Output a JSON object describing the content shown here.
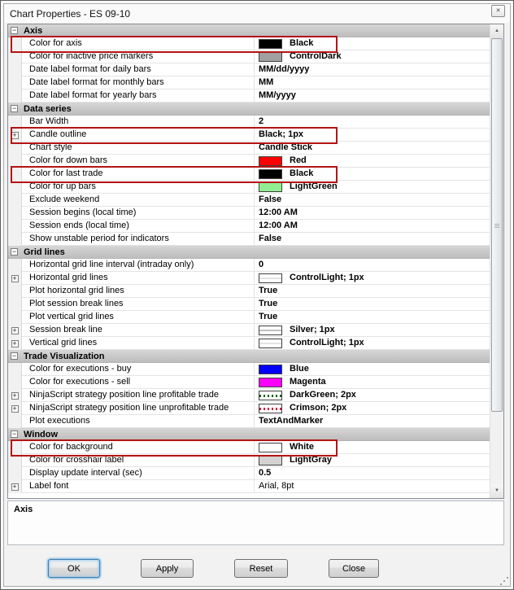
{
  "window": {
    "title": "Chart Properties - ES 09-10"
  },
  "icons": {
    "close": "✕",
    "collapse": "−",
    "expand": "+",
    "scroll_up": "▲",
    "scroll_down": "▼"
  },
  "grid": {
    "sections": [
      {
        "label": "Axis",
        "rows": [
          {
            "name": "Color for axis",
            "value": "Black",
            "swatch": {
              "type": "solid",
              "color": "#000000"
            },
            "highlighted": true
          },
          {
            "name": "Color for inactive price markers",
            "value": "ControlDark",
            "swatch": {
              "type": "solid",
              "color": "#A0A0A0"
            }
          },
          {
            "name": "Date label format for daily bars",
            "value": "MM/dd/yyyy"
          },
          {
            "name": "Date label format for monthly bars",
            "value": "MM"
          },
          {
            "name": "Date label format for yearly bars",
            "value": "MM/yyyy"
          }
        ]
      },
      {
        "label": "Data series",
        "rows": [
          {
            "name": "Bar Width",
            "value": "2"
          },
          {
            "name": "Candle outline",
            "value": "Black; 1px",
            "expandable": true,
            "highlighted": true
          },
          {
            "name": "Chart style",
            "value": "Candle Stick"
          },
          {
            "name": "Color for down bars",
            "value": "Red",
            "swatch": {
              "type": "solid",
              "color": "#FF0000"
            }
          },
          {
            "name": "Color for last trade",
            "value": "Black",
            "swatch": {
              "type": "solid",
              "color": "#000000"
            },
            "highlighted": true
          },
          {
            "name": "Color for up bars",
            "value": "LightGreen",
            "swatch": {
              "type": "solid",
              "color": "#90EE90"
            }
          },
          {
            "name": "Exclude weekend",
            "value": "False"
          },
          {
            "name": "Session begins (local time)",
            "value": "12:00 AM"
          },
          {
            "name": "Session ends (local time)",
            "value": "12:00 AM"
          },
          {
            "name": "Show unstable period for indicators",
            "value": "False"
          }
        ]
      },
      {
        "label": "Grid lines",
        "rows": [
          {
            "name": "Horizontal grid line interval (intraday only)",
            "value": "0"
          },
          {
            "name": "Horizontal grid lines",
            "value": "ControlLight; 1px",
            "expandable": true,
            "swatch": {
              "type": "line",
              "color": "#E3E3E3"
            }
          },
          {
            "name": "Plot horizontal grid lines",
            "value": "True"
          },
          {
            "name": "Plot session break lines",
            "value": "True"
          },
          {
            "name": "Plot vertical grid lines",
            "value": "True"
          },
          {
            "name": "Session break line",
            "value": "Silver; 1px",
            "expandable": true,
            "swatch": {
              "type": "line",
              "color": "#C0C0C0"
            }
          },
          {
            "name": "Vertical grid lines",
            "value": "ControlLight; 1px",
            "expandable": true,
            "swatch": {
              "type": "line",
              "color": "#E3E3E3"
            }
          }
        ]
      },
      {
        "label": "Trade Visualization",
        "rows": [
          {
            "name": "Color for executions - buy",
            "value": "Blue",
            "swatch": {
              "type": "solid",
              "color": "#0000FF"
            }
          },
          {
            "name": "Color for executions - sell",
            "value": "Magenta",
            "swatch": {
              "type": "solid",
              "color": "#FF00FF"
            }
          },
          {
            "name": "NinjaScript strategy position line profitable trade",
            "value": "DarkGreen; 2px",
            "expandable": true,
            "swatch": {
              "type": "dotted",
              "color": "#006400"
            }
          },
          {
            "name": "NinjaScript strategy position line unprofitable trade",
            "value": "Crimson; 2px",
            "expandable": true,
            "swatch": {
              "type": "dotted",
              "color": "#DC143C"
            }
          },
          {
            "name": "Plot executions",
            "value": "TextAndMarker"
          }
        ]
      },
      {
        "label": "Window",
        "rows": [
          {
            "name": "Color for background",
            "value": "White",
            "swatch": {
              "type": "solid",
              "color": "#FFFFFF"
            },
            "highlighted": true
          },
          {
            "name": "Color for crosshair label",
            "value": "LightGray",
            "swatch": {
              "type": "solid",
              "color": "#D3D3D3"
            }
          },
          {
            "name": "Display update interval (sec)",
            "value": "0.5"
          },
          {
            "name": "Label font",
            "value": "Arial, 8pt",
            "expandable": true,
            "value_bold": false
          }
        ]
      }
    ]
  },
  "description": {
    "title": "Axis"
  },
  "footer": {
    "buttons": [
      "OK",
      "Apply",
      "Reset",
      "Close"
    ]
  },
  "colors": {
    "annotation_box": "#B41414",
    "grid_border": "#898C95",
    "section_header": "#C6C6C6"
  }
}
